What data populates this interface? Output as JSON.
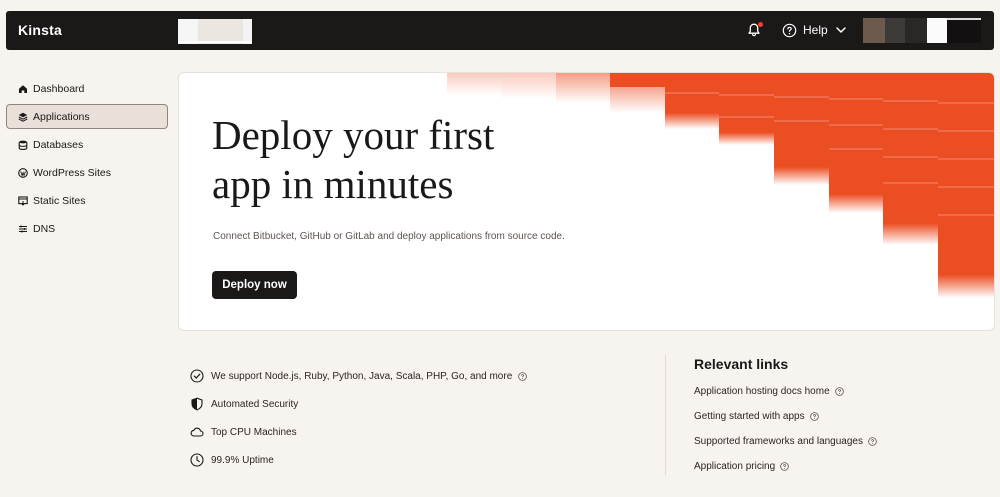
{
  "brand": {
    "name": "Kinsta"
  },
  "header": {
    "help_label": "Help",
    "icons": [
      "bell-icon",
      "help-icon",
      "chevron-down-icon"
    ]
  },
  "sidebar": {
    "items": [
      {
        "label": "Dashboard",
        "icon": "home-icon",
        "active": false
      },
      {
        "label": "Applications",
        "icon": "stack-icon",
        "active": true
      },
      {
        "label": "Databases",
        "icon": "database-icon",
        "active": false
      },
      {
        "label": "WordPress Sites",
        "icon": "wordpress-icon",
        "active": false
      },
      {
        "label": "Static Sites",
        "icon": "static-site-icon",
        "active": false
      },
      {
        "label": "DNS",
        "icon": "dns-icon",
        "active": false
      }
    ]
  },
  "hero": {
    "title": "Deploy your first\napp in minutes",
    "description": "Connect Bitbucket, GitHub or GitLab and deploy applications from source code.",
    "cta_label": "Deploy now"
  },
  "features": [
    {
      "label": "We support Node.js, Ruby, Python, Java, Scala, PHP, Go, and more",
      "icon": "check-circle-icon",
      "has_help": true
    },
    {
      "label": "Automated Security",
      "icon": "shield-icon",
      "has_help": false
    },
    {
      "label": "Top CPU Machines",
      "icon": "cloud-icon",
      "has_help": false
    },
    {
      "label": "99.9% Uptime",
      "icon": "clock-icon",
      "has_help": false
    }
  ],
  "relevant_links": {
    "title": "Relevant links",
    "items": [
      {
        "label": "Application hosting docs home"
      },
      {
        "label": "Getting started with apps"
      },
      {
        "label": "Supported frameworks and languages"
      },
      {
        "label": "Application pricing"
      }
    ]
  },
  "colors": {
    "accent": "#ec4e24",
    "topbar": "#1b1818",
    "background": "#f7f3ef",
    "notification": "#ff3b2f"
  }
}
